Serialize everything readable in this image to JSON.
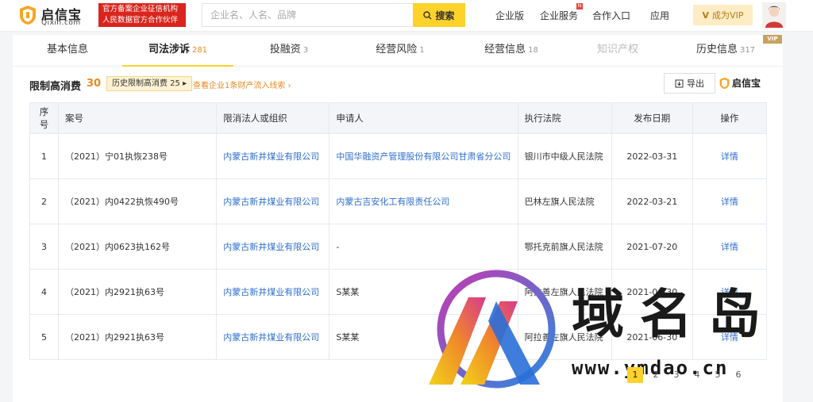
{
  "header": {
    "logo_cn": "启信宝",
    "logo_en": "Qixin.com",
    "official_line1": "官方备案企业征信机构",
    "official_line2": "人民数据官方合作伙伴",
    "search_placeholder": "企业名、人名、品牌",
    "search_button": "搜索",
    "nav": [
      "企业版",
      "企业服务",
      "合作入口",
      "应用"
    ],
    "vip_button": "成为VIP"
  },
  "tabs": [
    {
      "label": "基本信息",
      "count": ""
    },
    {
      "label": "司法涉诉",
      "count": "281"
    },
    {
      "label": "投融资",
      "count": "3"
    },
    {
      "label": "经营风险",
      "count": "1"
    },
    {
      "label": "经营信息",
      "count": "18"
    },
    {
      "label": "知识产权",
      "count": ""
    },
    {
      "label": "历史信息",
      "count": "317"
    }
  ],
  "vip_corner": "VIP",
  "section": {
    "title": "限制高消费",
    "count": "30",
    "history_button": "历史限制高消费 25 ▸",
    "asset_link": "查看企业1条财产流入线索 ›",
    "export_button": "导出",
    "brand": "启信宝"
  },
  "table": {
    "headers": [
      "序号",
      "案号",
      "限消法人或组织",
      "申请人",
      "执行法院",
      "发布日期",
      "操作"
    ],
    "rows": [
      {
        "no": "1",
        "case": "（2021）宁01执恢238号",
        "org": "内蒙古新井煤业有限公司",
        "applicant": "中国华融资产管理股份有限公司甘肃省分公司",
        "applicant_link": true,
        "court": "银川市中级人民法院",
        "date": "2022-03-31",
        "action": "详情"
      },
      {
        "no": "2",
        "case": "（2021）内0422执恢490号",
        "org": "内蒙古新井煤业有限公司",
        "applicant": "内蒙古吉安化工有限责任公司",
        "applicant_link": true,
        "court": "巴林左旗人民法院",
        "date": "2022-03-21",
        "action": "详情"
      },
      {
        "no": "3",
        "case": "（2021）内0623执162号",
        "org": "内蒙古新井煤业有限公司",
        "applicant": "-",
        "applicant_link": false,
        "court": "鄂托克前旗人民法院",
        "date": "2021-07-20",
        "action": "详情"
      },
      {
        "no": "4",
        "case": "（2021）内2921执63号",
        "org": "内蒙古新井煤业有限公司",
        "applicant": "S某某",
        "applicant_link": false,
        "court": "阿拉善左旗人民法院",
        "date": "2021-06-30",
        "action": "详情"
      },
      {
        "no": "5",
        "case": "（2021）内2921执63号",
        "org": "内蒙古新井煤业有限公司",
        "applicant": "S某某",
        "applicant_link": false,
        "court": "阿拉善左旗人民法院",
        "date": "2021-06-30",
        "action": "详情"
      }
    ]
  },
  "pagination": [
    "1",
    "2",
    "3",
    "4",
    "5",
    "6"
  ],
  "watermark": {
    "cn": "域名岛",
    "url": "www.ymdao.cn"
  },
  "colors": {
    "accent": "#fdd22a",
    "link": "#2f6fd0",
    "count": "#e88a1f",
    "badge_red": "#d9251d"
  }
}
